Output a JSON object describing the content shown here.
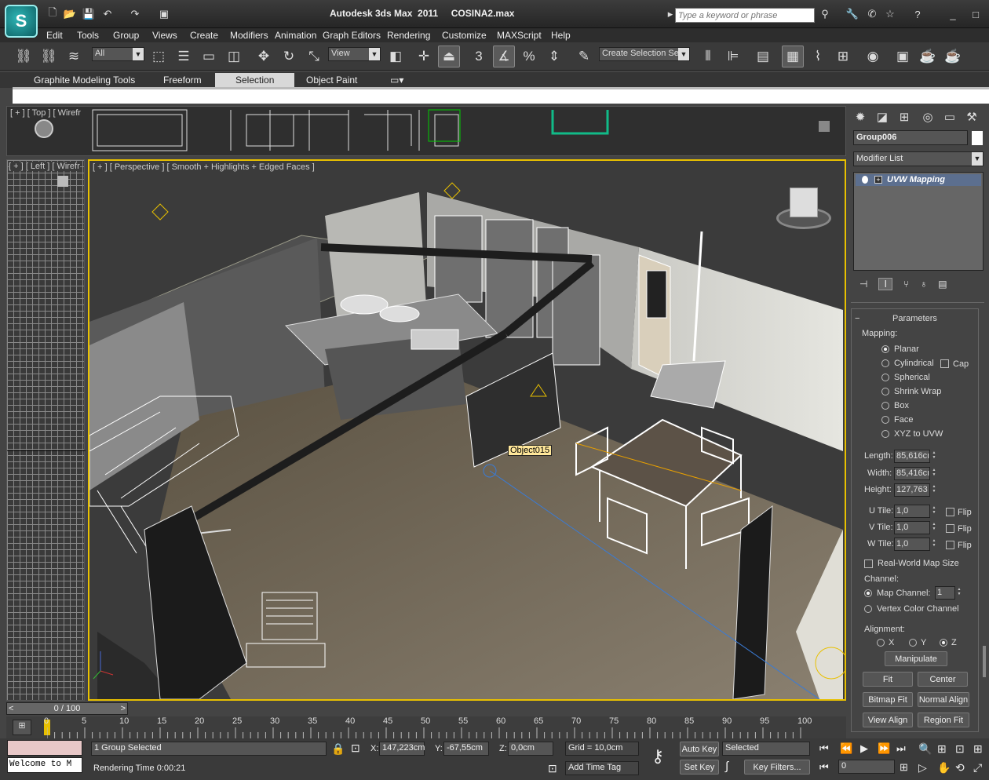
{
  "app": {
    "title": "Autodesk 3ds Max  2011",
    "file": "COSINA2.max",
    "logo_icon": "3dsmax-logo-icon"
  },
  "search": {
    "placeholder": "Type a keyword or phrase"
  },
  "menu": [
    "Edit",
    "Tools",
    "Group",
    "Views",
    "Create",
    "Modifiers",
    "Animation",
    "Graph Editors",
    "Rendering",
    "Customize",
    "MAXScript",
    "Help"
  ],
  "toolbar": {
    "selection_filter": "All",
    "ref_coord": "View",
    "named_selection": "Create Selection Se",
    "snap_label": "3",
    "angle_label": "%"
  },
  "ribbon": {
    "tabs": [
      "Graphite Modeling Tools",
      "Freeform",
      "Selection",
      "Object Paint"
    ],
    "selected": "Selection"
  },
  "viewports": {
    "top": "[ + ] [ Top ] [ Wirefr",
    "left": "[ + ] [ Left ] [ Wirefr",
    "perspective": "[ + ] [ Perspective ] [ Smooth + Highlights + Edged Faces ]",
    "tooltip": "Object015"
  },
  "command_panel": {
    "object_name": "Group006",
    "modifier_list": "Modifier List",
    "stack_item": "UVW Mapping",
    "rollout": "Parameters",
    "mapping_label": "Mapping:",
    "mapping_options": [
      "Planar",
      "Cylindrical",
      "Spherical",
      "Shrink Wrap",
      "Box",
      "Face",
      "XYZ to UVW"
    ],
    "mapping_selected": "Planar",
    "cap_label": "Cap",
    "length_label": "Length:",
    "length": "85,616cı",
    "width_label": "Width:",
    "width": "85,416cı",
    "height_label": "Height:",
    "height": "127,763",
    "u_tile_label": "U Tile:",
    "u_tile": "1,0",
    "v_tile_label": "V Tile:",
    "v_tile": "1,0",
    "w_tile_label": "W Tile:",
    "w_tile": "1,0",
    "flip_label": "Flip",
    "real_world_label": "Real-World Map Size",
    "channel_label": "Channel:",
    "map_channel_label": "Map Channel:",
    "map_channel": "1",
    "vertex_color_label": "Vertex Color Channel",
    "alignment_label": "Alignment:",
    "axes": [
      "X",
      "Y",
      "Z"
    ],
    "axis_selected": "Z",
    "buttons": [
      "Manipulate",
      "Fit",
      "Center",
      "Bitmap Fit",
      "Normal Align",
      "View Align",
      "Region Fit"
    ]
  },
  "timeline": {
    "slider": "0 / 100",
    "ticks": [
      "0",
      "5",
      "10",
      "15",
      "20",
      "25",
      "30",
      "35",
      "40",
      "45",
      "50",
      "55",
      "60",
      "65",
      "70",
      "75",
      "80",
      "85",
      "90",
      "95",
      "100"
    ]
  },
  "status": {
    "script_listener": "Welcome to M",
    "selection": "1 Group Selected",
    "render_time": "Rendering Time  0:00:21",
    "x_label": "X:",
    "x": "147,223cm",
    "y_label": "Y:",
    "y": "-67,55cm",
    "z_label": "Z:",
    "z": "0,0cm",
    "grid": "Grid = 10,0cm",
    "add_time_tag": "Add Time Tag",
    "auto_key": "Auto Key",
    "set_key": "Set Key",
    "key_mode": "Selected",
    "key_filters": "Key Filters...",
    "frame": "0"
  }
}
